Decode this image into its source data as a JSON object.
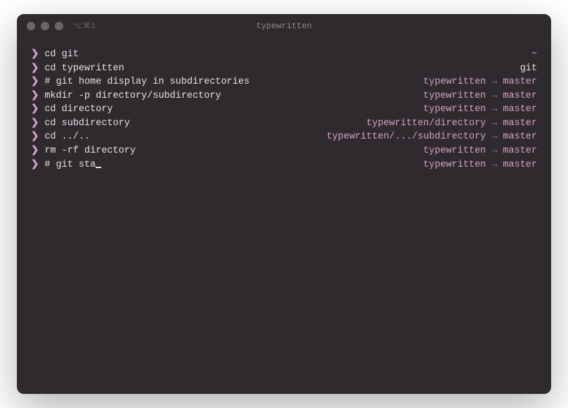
{
  "window": {
    "title": "typewritten",
    "tab_hint": "⌥⌘1"
  },
  "prompt_symbol": "❯",
  "arrow": "→",
  "lines": [
    {
      "command": "cd git",
      "path": "~",
      "branch": ""
    },
    {
      "command": "cd typewritten",
      "path": "git",
      "branch": ""
    },
    {
      "command": "# git home display in subdirectories",
      "path": "typewritten",
      "branch": "master"
    },
    {
      "command": "mkdir -p directory/subdirectory",
      "path": "typewritten",
      "branch": "master"
    },
    {
      "command": "cd directory",
      "path": "typewritten",
      "branch": "master"
    },
    {
      "command": "cd subdirectory",
      "path": "typewritten/directory",
      "branch": "master"
    },
    {
      "command": "cd ../..",
      "path": "typewritten/.../subdirectory",
      "branch": "master"
    },
    {
      "command": "rm -rf directory",
      "path": "typewritten",
      "branch": "master"
    },
    {
      "command": "# git sta",
      "path": "typewritten",
      "branch": "master",
      "cursor": true
    }
  ]
}
